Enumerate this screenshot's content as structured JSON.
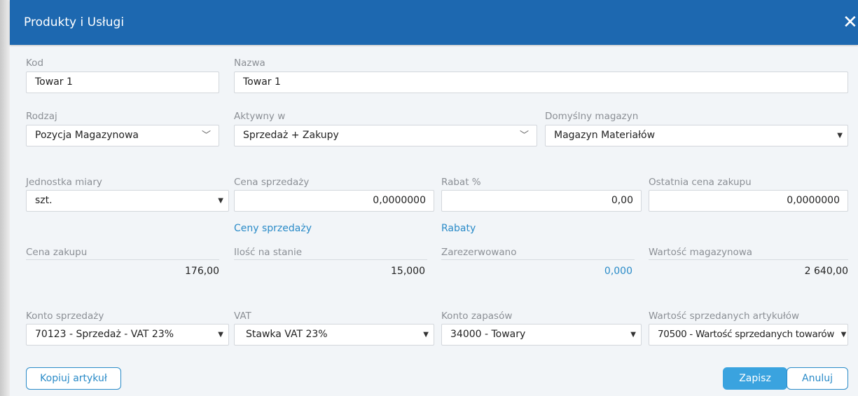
{
  "dialog": {
    "title": "Produkty i Usługi",
    "close_symbol": "✕"
  },
  "fields": {
    "kod": {
      "label": "Kod",
      "value": "Towar 1"
    },
    "nazwa": {
      "label": "Nazwa",
      "value": "Towar 1"
    },
    "rodzaj": {
      "label": "Rodzaj",
      "value": "Pozycja Magazynowa"
    },
    "aktywny": {
      "label": "Aktywny w",
      "value": "Sprzedaż + Zakupy"
    },
    "magazyn": {
      "label": "Domyślny magazyn",
      "value": "Magazyn Materiałów"
    },
    "jednostka": {
      "label": "Jednostka miary",
      "value": "szt."
    },
    "cena_sprzedazy": {
      "label": "Cena sprzedaży",
      "value": "0,0000000"
    },
    "rabat": {
      "label": "Rabat %",
      "value": "0,00"
    },
    "ostatnia_cena": {
      "label": "Ostatnia cena zakupu",
      "value": "0,0000000"
    },
    "cena_zakupu": {
      "label": "Cena zakupu",
      "value": "176,00"
    },
    "ilosc": {
      "label": "Ilość na stanie",
      "value": "15,000"
    },
    "zarezerwowano": {
      "label": "Zarezerwowano",
      "value": "0,000"
    },
    "wartosc_mag": {
      "label": "Wartość magazynowa",
      "value": "2 640,00"
    },
    "konto_sprzedazy": {
      "label": "Konto sprzedaży",
      "value": "70123 - Sprzedaż - VAT 23%"
    },
    "vat": {
      "label": "VAT",
      "value": "Stawka VAT 23%"
    },
    "konto_zapasow": {
      "label": "Konto zapasów",
      "value": "34000 - Towary"
    },
    "wartosc_sprzedanych": {
      "label": "Wartość sprzedanych artykułów",
      "value": "70500 - Wartość sprzedanych towarów"
    }
  },
  "links": {
    "ceny_sprzedazy": "Ceny sprzedaży",
    "rabaty": "Rabaty"
  },
  "buttons": {
    "kopiuj": "Kopiuj artykuł",
    "zapisz": "Zapisz",
    "anuluj": "Anuluj"
  },
  "icons": {
    "caret": "▼",
    "chevron": "﹀"
  },
  "colors": {
    "titlebar": "#1d68b0",
    "link": "#2a8bc8",
    "primary_button": "#3aa3df",
    "background": "#f2f5f8"
  }
}
